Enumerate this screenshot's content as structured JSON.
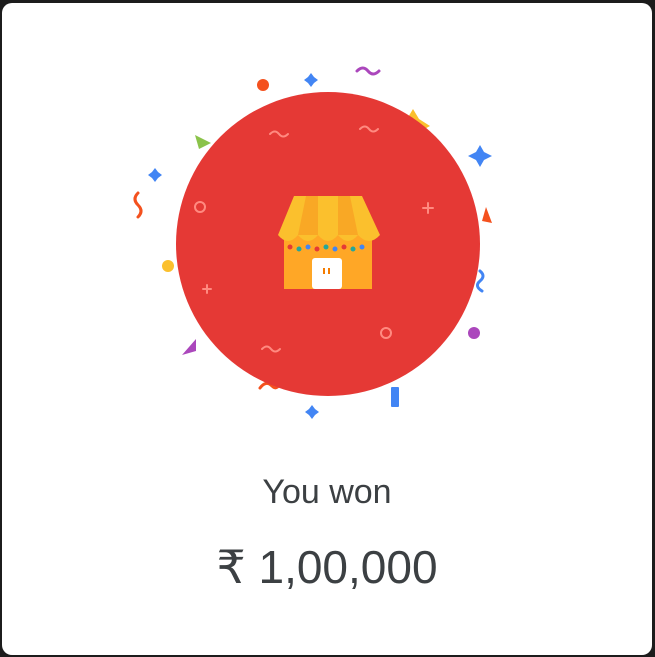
{
  "reward": {
    "label": "You won",
    "amount": "₹ 1,00,000",
    "icon": "storefront-icon"
  },
  "colors": {
    "circle": "#e53935",
    "awning_yellow": "#fbc02d",
    "awning_orange": "#f9a825",
    "shop_body": "#ffa726",
    "text": "#3c4043"
  }
}
